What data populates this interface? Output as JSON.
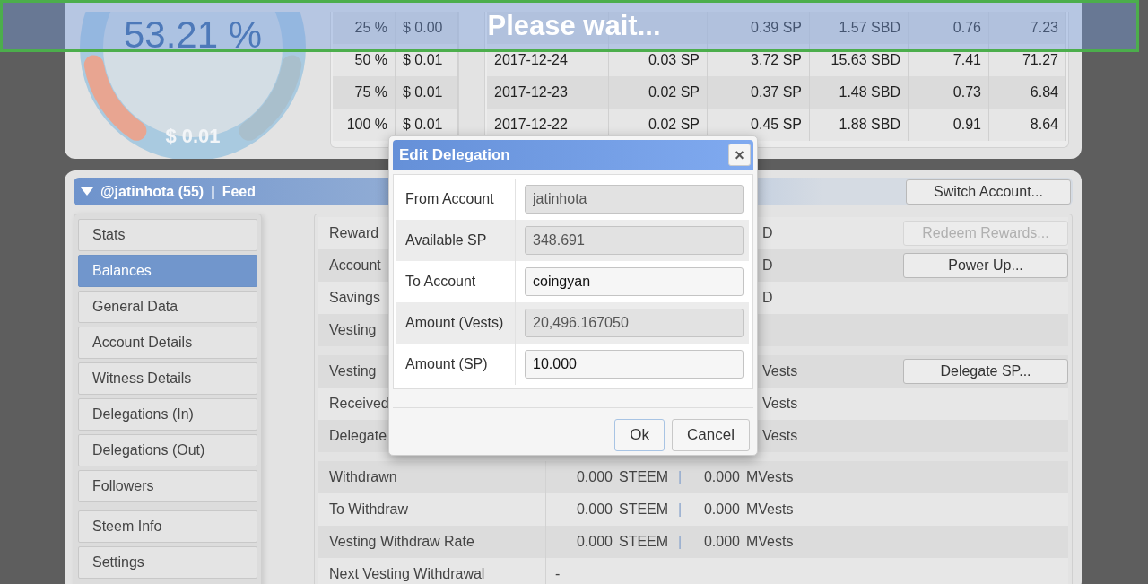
{
  "gauge": {
    "percent": "53.21 %",
    "amount": "$ 0.01"
  },
  "vote_table": {
    "rows": [
      {
        "percent": "25 %",
        "value": "$ 0.00"
      },
      {
        "percent": "50 %",
        "value": "$ 0.01"
      },
      {
        "percent": "75 %",
        "value": "$ 0.01"
      },
      {
        "percent": "100 %",
        "value": "$ 0.01"
      }
    ]
  },
  "history_table": {
    "rows": [
      {
        "date": "",
        "c2": "",
        "c3": "0.39 SP",
        "c4": "1.57 SBD",
        "c5": "0.76",
        "c6": "7.23"
      },
      {
        "date": "2017-12-24",
        "c2": "0.03 SP",
        "c3": "3.72 SP",
        "c4": "15.63 SBD",
        "c5": "7.41",
        "c6": "71.27"
      },
      {
        "date": "2017-12-23",
        "c2": "0.02 SP",
        "c3": "0.37 SP",
        "c4": "1.48 SBD",
        "c5": "0.73",
        "c6": "6.84"
      },
      {
        "date": "2017-12-22",
        "c2": "0.02 SP",
        "c3": "0.45 SP",
        "c4": "1.88 SBD",
        "c5": "0.91",
        "c6": "8.64"
      }
    ]
  },
  "banner": {
    "text": "Please wait..."
  },
  "account_bar": {
    "account": "@jatinhota (55)",
    "separator": "|",
    "link": "Feed",
    "button": "Switch Account..."
  },
  "sidebar": {
    "sections": [
      {
        "items": [
          {
            "label": "Stats",
            "selected": false
          },
          {
            "label": "Balances",
            "selected": true
          },
          {
            "label": "General Data",
            "selected": false
          },
          {
            "label": "Account Details",
            "selected": false
          },
          {
            "label": "Witness Details",
            "selected": false
          },
          {
            "label": "Delegations (In)",
            "selected": false
          },
          {
            "label": "Delegations (Out)",
            "selected": false
          },
          {
            "label": "Followers",
            "selected": false
          }
        ]
      },
      {
        "items": [
          {
            "label": "Steem Info",
            "selected": false
          },
          {
            "label": "Settings",
            "selected": false
          }
        ]
      }
    ]
  },
  "balances": {
    "sections": [
      {
        "rows": [
          {
            "kind": "partial",
            "label": "Reward",
            "value": "D",
            "button": {
              "label": "Redeem Rewards...",
              "disabled": true
            }
          },
          {
            "kind": "partial",
            "label": "Account",
            "value": "D",
            "button": {
              "label": "Power Up...",
              "disabled": false
            }
          },
          {
            "kind": "partial",
            "label": "Savings",
            "value": "D"
          },
          {
            "kind": "partial",
            "label": "Vesting"
          }
        ]
      },
      {
        "rows": [
          {
            "kind": "partial",
            "label": "Vesting",
            "value": "Vests",
            "button": {
              "label": "Delegate SP...",
              "disabled": false
            }
          },
          {
            "kind": "partial",
            "label": "Received",
            "value": "Vests"
          },
          {
            "kind": "partial",
            "label": "Delegate",
            "value": "Vests"
          }
        ]
      },
      {
        "rows": [
          {
            "kind": "full",
            "label": "Withdrawn",
            "amount1": "0.000",
            "unit1": "STEEM",
            "separator": "|",
            "amount2": "0.000",
            "unit2": "MVests"
          },
          {
            "kind": "full",
            "label": "To Withdraw",
            "amount1": "0.000",
            "unit1": "STEEM",
            "separator": "|",
            "amount2": "0.000",
            "unit2": "MVests"
          },
          {
            "kind": "full",
            "label": "Vesting Withdraw Rate",
            "amount1": "0.000",
            "unit1": "STEEM",
            "separator": "|",
            "amount2": "0.000",
            "unit2": "MVests"
          },
          {
            "kind": "single",
            "label": "Next Vesting Withdrawal",
            "value": "-"
          }
        ]
      }
    ]
  },
  "dialog": {
    "title": "Edit Delegation",
    "close": "×",
    "fields": [
      {
        "label": "From Account",
        "value": "jatinhota",
        "readonly": true
      },
      {
        "label": "Available SP",
        "value": "348.691",
        "readonly": true
      },
      {
        "label": "To Account",
        "value": "coingyan",
        "readonly": false
      },
      {
        "label": "Amount (Vests)",
        "value": "20,496.167050",
        "readonly": true
      },
      {
        "label": "Amount (SP)",
        "value": "10.000",
        "readonly": false
      }
    ],
    "buttons": [
      {
        "label": "Ok",
        "primary": true
      },
      {
        "label": "Cancel",
        "primary": false
      }
    ]
  }
}
